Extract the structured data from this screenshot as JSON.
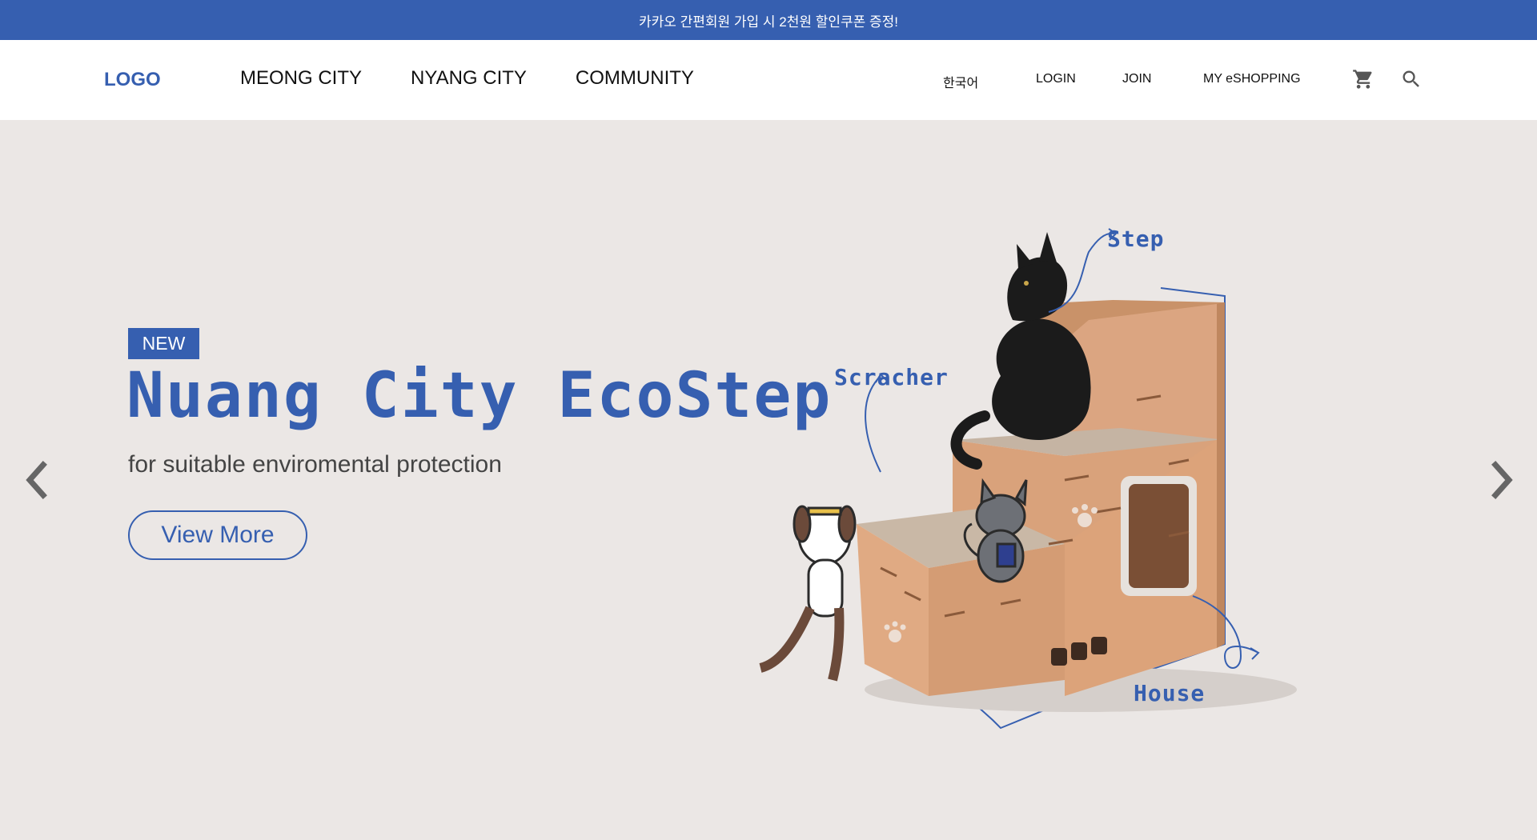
{
  "promo_bar": {
    "text": "카카오 간편회원 가입 시 2천원 할인쿠폰 증정!"
  },
  "header": {
    "logo": "LOGO",
    "nav": [
      {
        "label": "MEONG CITY"
      },
      {
        "label": "NYANG CITY"
      },
      {
        "label": "COMMUNITY"
      }
    ],
    "util": {
      "language": "한국어",
      "login": "LOGIN",
      "join": "JOIN",
      "my_shopping": "MY eSHOPPING"
    },
    "icons": {
      "cart": "cart-icon",
      "search": "search-icon"
    }
  },
  "hero": {
    "badge": "NEW",
    "title": "Nuang City EcoStep",
    "subtitle": "for suitable enviromental protection",
    "cta": "View More",
    "product_labels": {
      "step": "Step",
      "scratcher": "Scracher",
      "house": "House"
    },
    "icons": {
      "prev": "chevron-left-icon",
      "next": "chevron-right-icon"
    }
  },
  "colors": {
    "brand": "#365fb0",
    "hero_bg": "#ebe7e5",
    "cardboard": "#d9a27b"
  }
}
